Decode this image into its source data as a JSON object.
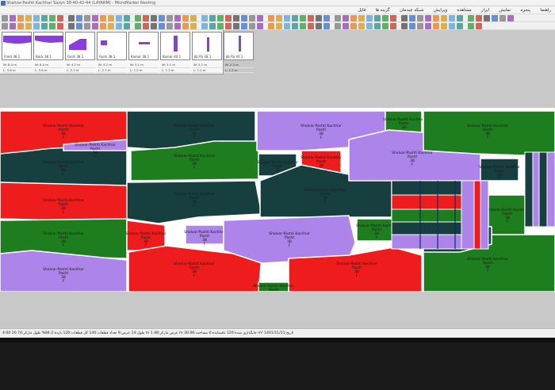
{
  "window": {
    "title": "Shalvar-Pashti Kachhar Sazyn 38-40-42-44 (LAYARM) - MicroMarker Nesting",
    "icon": "app-icon"
  },
  "menu": [
    "راهنما",
    "پنجره",
    "نمایش",
    "ابزار",
    "مشاهده",
    "ویرایش",
    "شبکه چیدمان",
    "گزینه ها",
    "فایل"
  ],
  "thumbnails": [
    {
      "label": "Front 38",
      "count": "1",
      "width": "8.4 m",
      "length": "3.6 m",
      "shape": "front-left"
    },
    {
      "label": "Back 38",
      "count": "1",
      "width": "8.4 m",
      "length": "3.6 m",
      "shape": "back-right"
    },
    {
      "label": "Fashi 38",
      "count": "1",
      "width": "4.2 m",
      "length": "2.7 m",
      "shape": "corner"
    },
    {
      "label": "Fashi 38",
      "count": "1",
      "width": "4.2 m",
      "length": "2.7 m",
      "shape": "corner-small"
    },
    {
      "label": "Kamar 38",
      "count": "1",
      "width": "3.1 m",
      "length": "1.2 m",
      "shape": "strip"
    },
    {
      "label": "Kamar 40",
      "count": "1",
      "width": "3.1 m",
      "length": "1.2 m",
      "shape": "bar"
    },
    {
      "label": "Jib Ro 38",
      "count": "1",
      "width": "2.2 m",
      "length": "1.2 m",
      "shape": "bar-thin"
    },
    {
      "label": "Jib Ro 40",
      "count": "1",
      "width": "2.2 m",
      "length": "1.2 m",
      "shape": "bar-thin2"
    }
  ],
  "pieceText": {
    "name": "Shalvar-Pashti Kachhar",
    "part": "Pasht",
    "size": "38",
    "grain": "F"
  },
  "colors": {
    "red": "#ee1c1c",
    "darkgreen": "#173f3f",
    "green": "#1e7d1e",
    "lavender": "#ac84ea",
    "purple": "#8a3ed8"
  },
  "status": {
    "text": "4:00  طول:14  عرض:9  تعداد قطعات:140  کل قطعات:120  بازده:84.2%  طول مارکر:20.74 m  عرض مارکر:1.48 m  جایگذاری شده:120  باقیمانده:0  مساحت:30.06 m²  تاریخ:1401/11/11"
  }
}
